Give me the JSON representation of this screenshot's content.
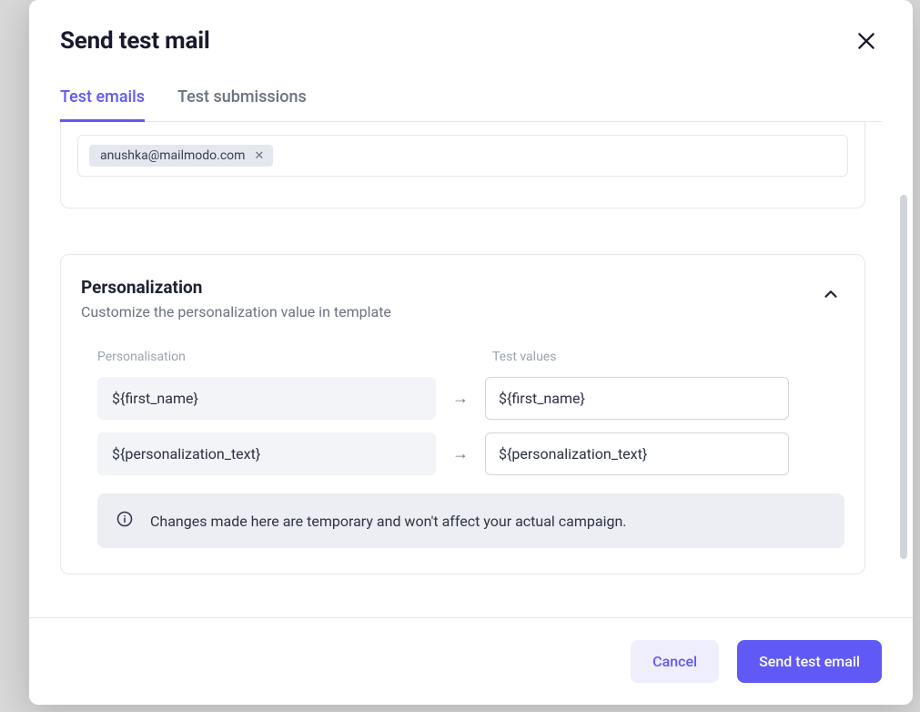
{
  "modal": {
    "title": "Send test mail",
    "tabs": [
      {
        "label": "Test emails",
        "active": true
      },
      {
        "label": "Test submissions",
        "active": false
      }
    ],
    "email_chip": "anushka@mailmodo.com",
    "section": {
      "title": "Personalization",
      "subtitle": "Customize the personalization value in template",
      "col_left": "Personalisation",
      "col_right": "Test values",
      "rows": [
        {
          "token": "${first_name}",
          "value": "${first_name}"
        },
        {
          "token": "${personalization_text}",
          "value": "${personalization_text}"
        }
      ],
      "info": "Changes made here are temporary and won't affect your actual campaign."
    },
    "footer": {
      "cancel": "Cancel",
      "send": "Send test email"
    }
  }
}
